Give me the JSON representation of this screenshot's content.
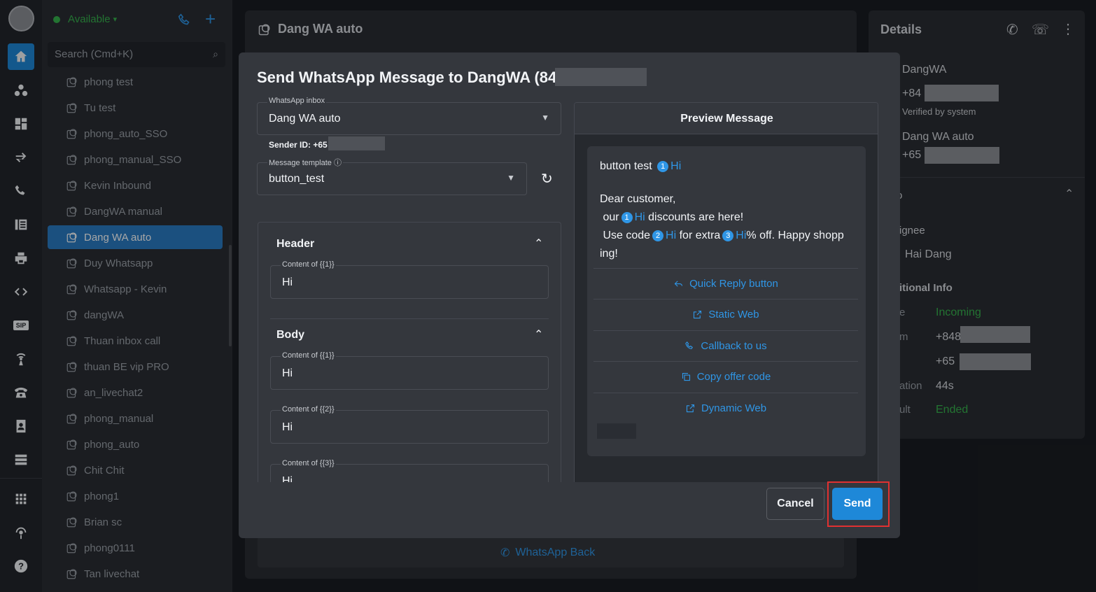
{
  "rail": {
    "items": [
      "home-icon",
      "contacts-icon",
      "dashboard-icon",
      "transfer-icon",
      "call-log-icon",
      "report-icon",
      "printer-icon",
      "code-icon",
      "sip-icon",
      "broadcast-icon",
      "phone-icon",
      "contact-book-icon",
      "server-icon",
      "apps-icon",
      "podcast-icon",
      "help-icon"
    ],
    "sip_label": "SIP"
  },
  "inbox": {
    "status": "Available",
    "search_placeholder": "Search (Cmd+K)",
    "items": [
      "phong test",
      "Tu test",
      "phong_auto_SSO",
      "phong_manual_SSO",
      "Kevin Inbound",
      "DangWA manual",
      "Dang WA auto",
      "Duy Whatsapp",
      "Whatsapp - Kevin",
      "dangWA",
      "Thuan inbox call",
      "thuan BE vip PRO",
      "an_livechat2",
      "phong_manual",
      "phong_auto",
      "Chit Chit",
      "phong1",
      "Brian sc",
      "phong0111",
      "Tan livechat"
    ],
    "active_index": 6
  },
  "main": {
    "title": "Dang WA auto",
    "whatsapp_back": "WhatsApp Back"
  },
  "details": {
    "title": "Details",
    "contact_name": "DangWA",
    "contact_phone": "+84",
    "verified": "Verified by system",
    "inbox_name": "Dang WA auto",
    "inbox_phone": "+65",
    "section_partial": "o",
    "assignee_label": "ignee",
    "assignee": "Hai Dang",
    "additional_info": "itional Info",
    "type_label": "e",
    "type_value": "Incoming",
    "from_label": "m",
    "from_value": "+848",
    "to_value": "+65",
    "duration_label": "ation",
    "duration_value": "44s",
    "result_label": "ult",
    "result_value": "Ended"
  },
  "modal": {
    "title": "Send WhatsApp Message to DangWA (84",
    "inbox_label": "WhatsApp inbox",
    "inbox_value": "Dang WA auto",
    "sender_id": "Sender ID: +65",
    "template_label": "Message template",
    "template_value": "button_test",
    "header_section": "Header",
    "header_content_label": "Content of {{1}}",
    "header_content_value": "Hi",
    "body_section": "Body",
    "body_fields": [
      {
        "label": "Content of {{1}}",
        "value": "Hi"
      },
      {
        "label": "Content of {{2}}",
        "value": "Hi"
      },
      {
        "label": "Content of {{3}}",
        "value": "Hi"
      }
    ],
    "preview_title": "Preview Message",
    "preview_header_text": "button test",
    "preview_var_hi": "Hi",
    "preview_line1": "Dear customer,",
    "preview_our": "our",
    "preview_discounts": "discounts are here!",
    "preview_use_code": "Use code",
    "preview_for_extra": "for extra",
    "preview_off": "% off. Happy shopp",
    "preview_ing": "ing!",
    "n1": "1",
    "n2": "2",
    "n3": "3",
    "buttons": [
      "Quick Reply button",
      "Static Web",
      "Callback to us",
      "Copy offer code",
      "Dynamic Web"
    ],
    "cancel": "Cancel",
    "send": "Send"
  },
  "colors": {
    "accent": "#2f96e6",
    "highlight": "#e03131",
    "success": "#37b24d"
  }
}
